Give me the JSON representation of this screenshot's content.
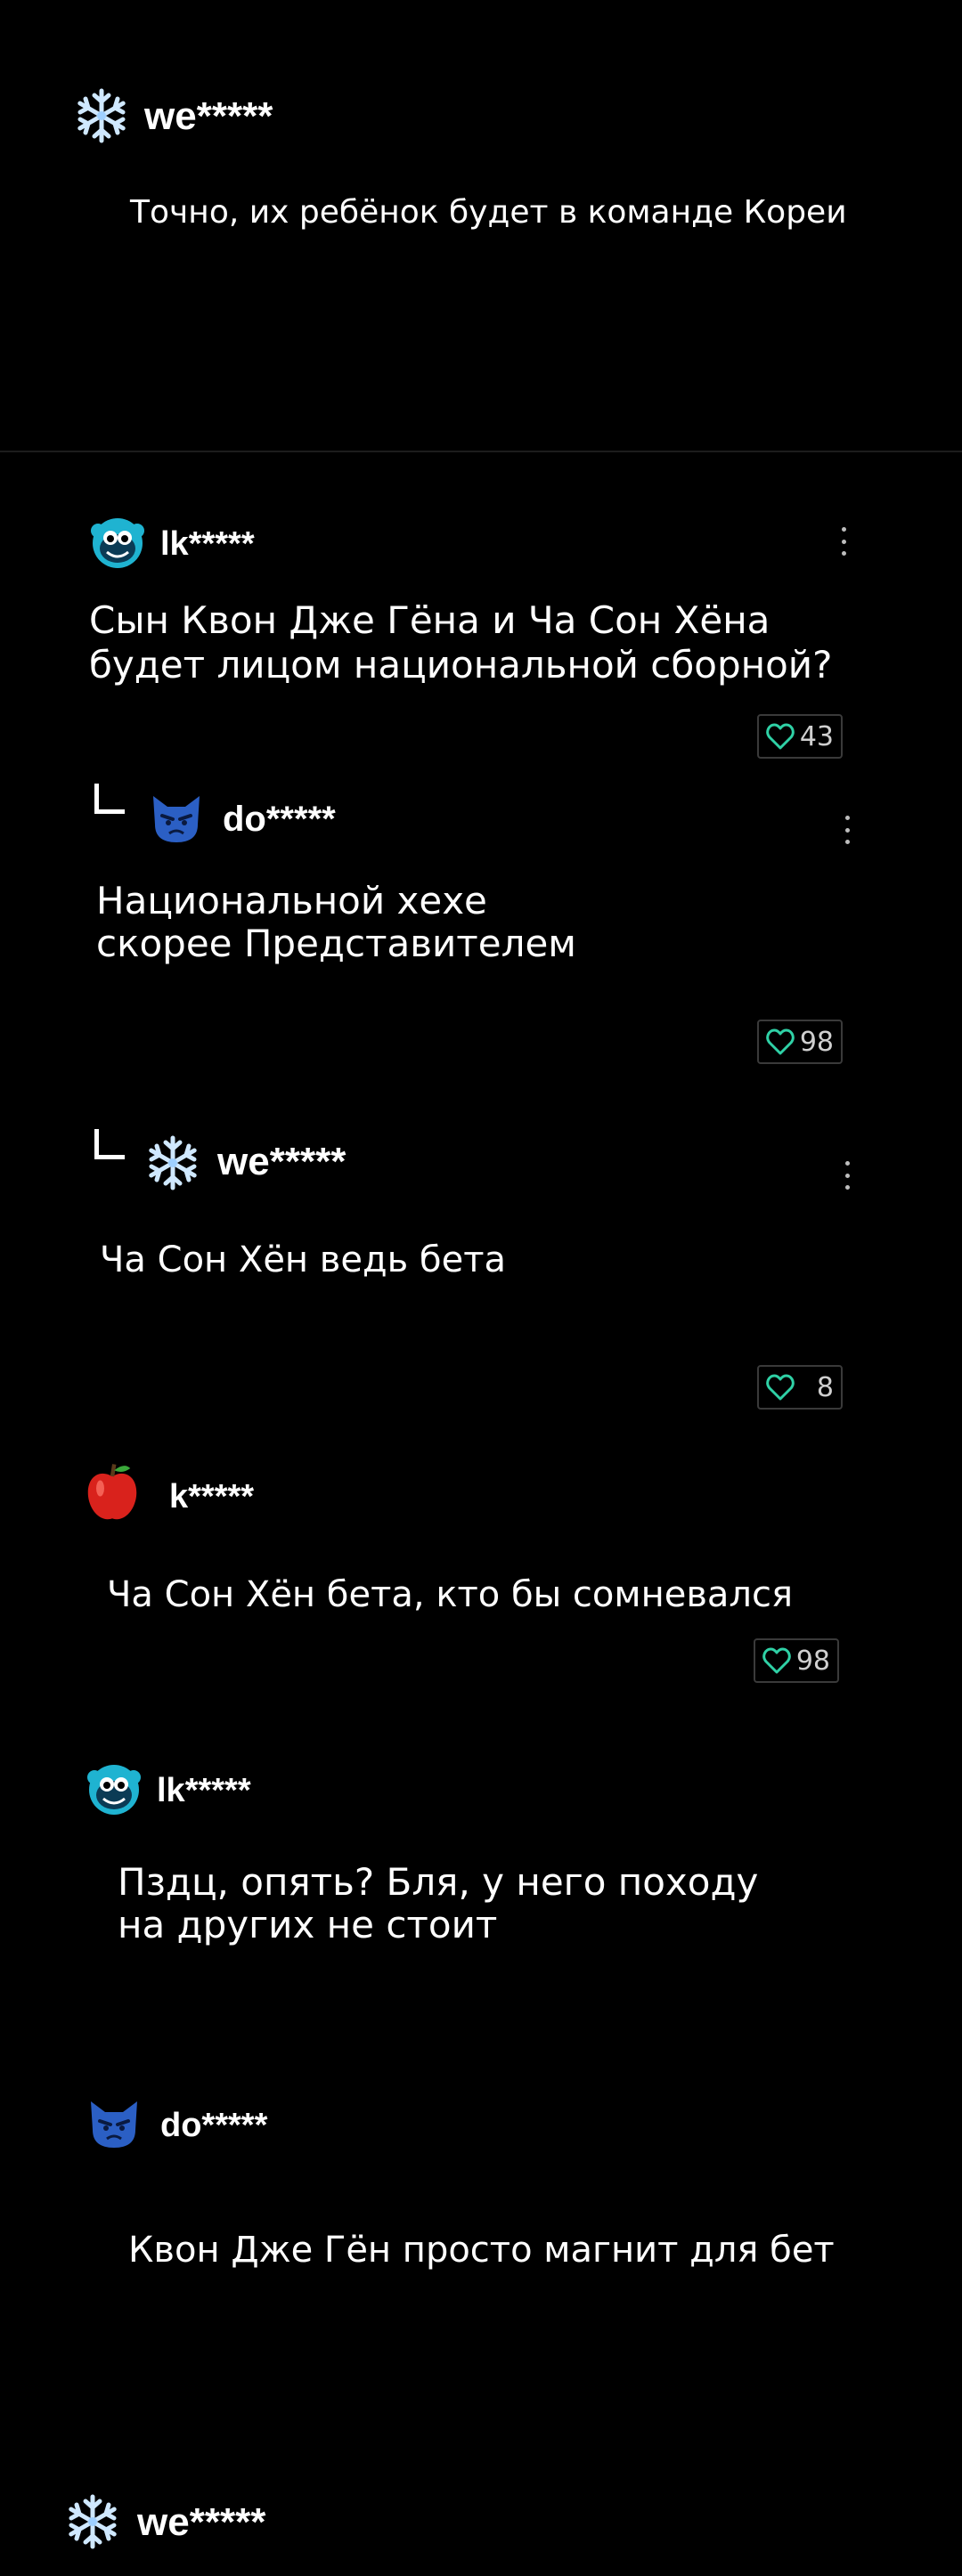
{
  "comments": [
    {
      "user": "we*****",
      "avatar": "snowflake-icon",
      "text": "Точно, их ребёнок будет в команде Кореи"
    },
    {
      "user": "lk*****",
      "avatar": "monkey-face-icon",
      "text": "Сын Квон Дже Гёна и Ча Сон Хёна\nбудет лицом национальной сборной?",
      "likes": "43"
    },
    {
      "user": "do*****",
      "avatar": "angry-cat-icon",
      "text": "Национальной хехе\nскорее Представителем",
      "likes": "98"
    },
    {
      "user": "we*****",
      "avatar": "snowflake-icon",
      "text": "Ча Сон Хён ведь бета",
      "likes": "8"
    },
    {
      "user": "k*****",
      "avatar": "red-apple-icon",
      "text": "Ча Сон Хён бета, кто бы сомневался",
      "likes": "98"
    },
    {
      "user": "lk*****",
      "avatar": "monkey-face-icon",
      "text": "Пздц, опять? Бля, у него походу\nна других не стоит"
    },
    {
      "user": "do*****",
      "avatar": "angry-cat-icon",
      "text": "Квон Дже Гён просто магнит для бет"
    },
    {
      "user": "we*****",
      "avatar": "snowflake-icon"
    }
  ],
  "colors": {
    "background": "#000000",
    "heart": "#2fd1a6",
    "border": "#3a3a3a"
  }
}
